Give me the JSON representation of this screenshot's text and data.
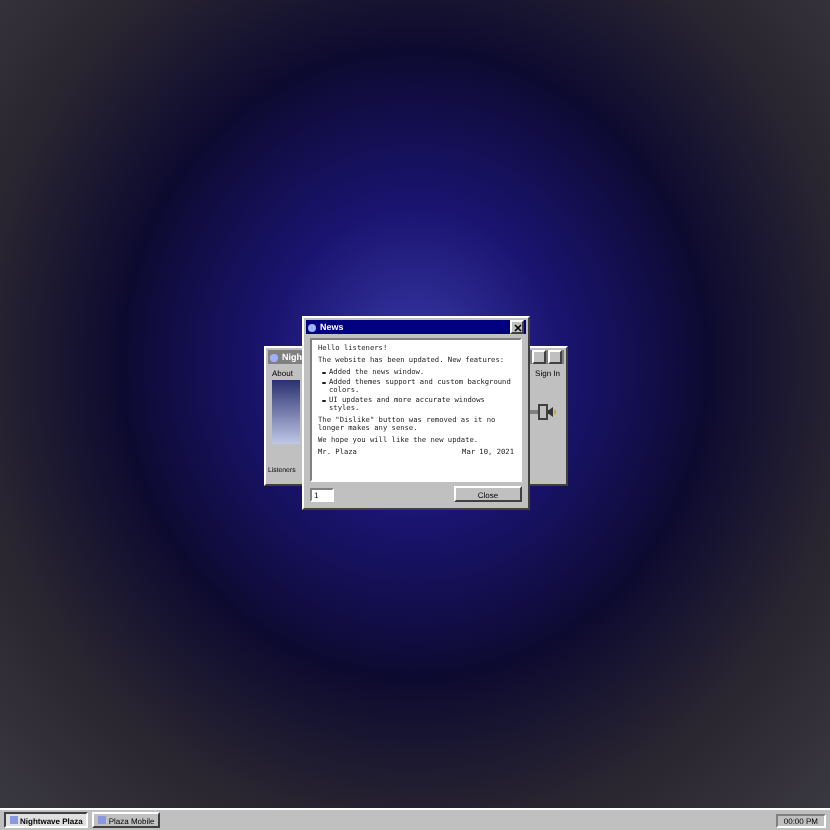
{
  "back_window": {
    "title": "Nigh",
    "menu": [
      "About"
    ],
    "sign_in": "Sign In",
    "listeners_label": "Listeners",
    "volume": {
      "level": 0.8
    }
  },
  "news_window": {
    "title": "News",
    "greeting": "Hello listeners!",
    "intro": "The website has been updated. New features:",
    "features": [
      "Added the news window.",
      "Added themes support and custom background colors.",
      "UI updates and more accurate windows styles."
    ],
    "note": "The \"Dislike\" button was removed as it no longer makes any sense.",
    "closing": "We hope you will like the new update.",
    "author": "Mr. Plaza",
    "date": "Mar 10, 2021",
    "page": "1",
    "close_button": "Close"
  },
  "taskbar": {
    "items": [
      {
        "label": "Nightwave Plaza",
        "selected": true
      },
      {
        "label": "Plaza Mobile",
        "selected": false
      }
    ],
    "clock": "00:00 PM"
  }
}
